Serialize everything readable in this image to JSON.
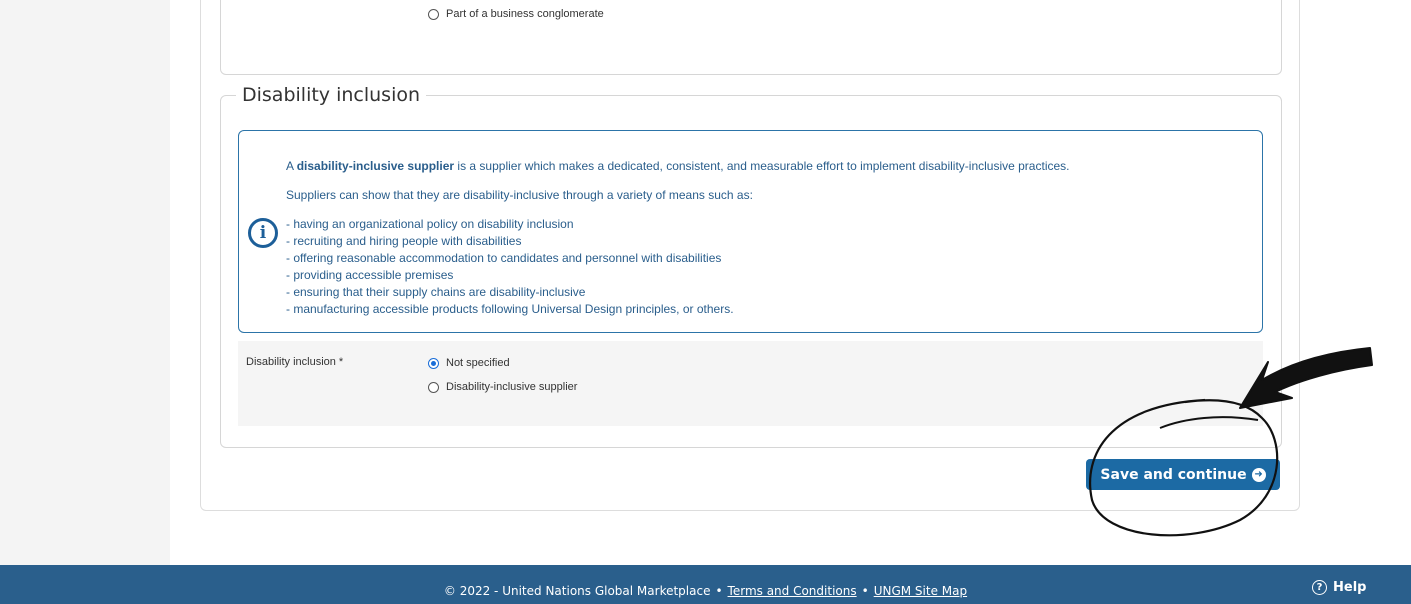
{
  "previous_section": {
    "option_label": "Part of a business conglomerate"
  },
  "section": {
    "title": "Disability inclusion"
  },
  "info": {
    "icon": "info-icon",
    "intro_prefix": "A ",
    "intro_bold": "disability-inclusive supplier",
    "intro_suffix": " is a supplier which makes a dedicated, consistent, and measurable effort to implement disability-inclusive practices.",
    "means_intro": "Suppliers can show that they are disability-inclusive through a variety of means such as:",
    "means": [
      "- having an organizational policy on disability inclusion",
      "- recruiting and hiring people with disabilities",
      "- offering reasonable accommodation to candidates and personnel with disabilities",
      "- providing accessible premises",
      "- ensuring that their supply chains are disability-inclusive",
      "- manufacturing accessible products following Universal Design principles, or others."
    ]
  },
  "form": {
    "label": "Disability inclusion *",
    "options": [
      {
        "label": "Not specified",
        "checked": true
      },
      {
        "label": "Disability-inclusive supplier",
        "checked": false
      }
    ]
  },
  "actions": {
    "save_label": "Save and continue",
    "save_icon": "arrow-circle-right-icon"
  },
  "footer": {
    "copyright": "© 2022 - United Nations Global Marketplace",
    "separator": "•",
    "terms_link": "Terms and Conditions",
    "sitemap_link": "UNGM Site Map",
    "help_label": "Help",
    "help_icon": "question-circle-icon"
  },
  "colors": {
    "primary": "#1c6aa4",
    "footer_bg": "#2a5f8c",
    "info_text": "#2a5e8c"
  }
}
